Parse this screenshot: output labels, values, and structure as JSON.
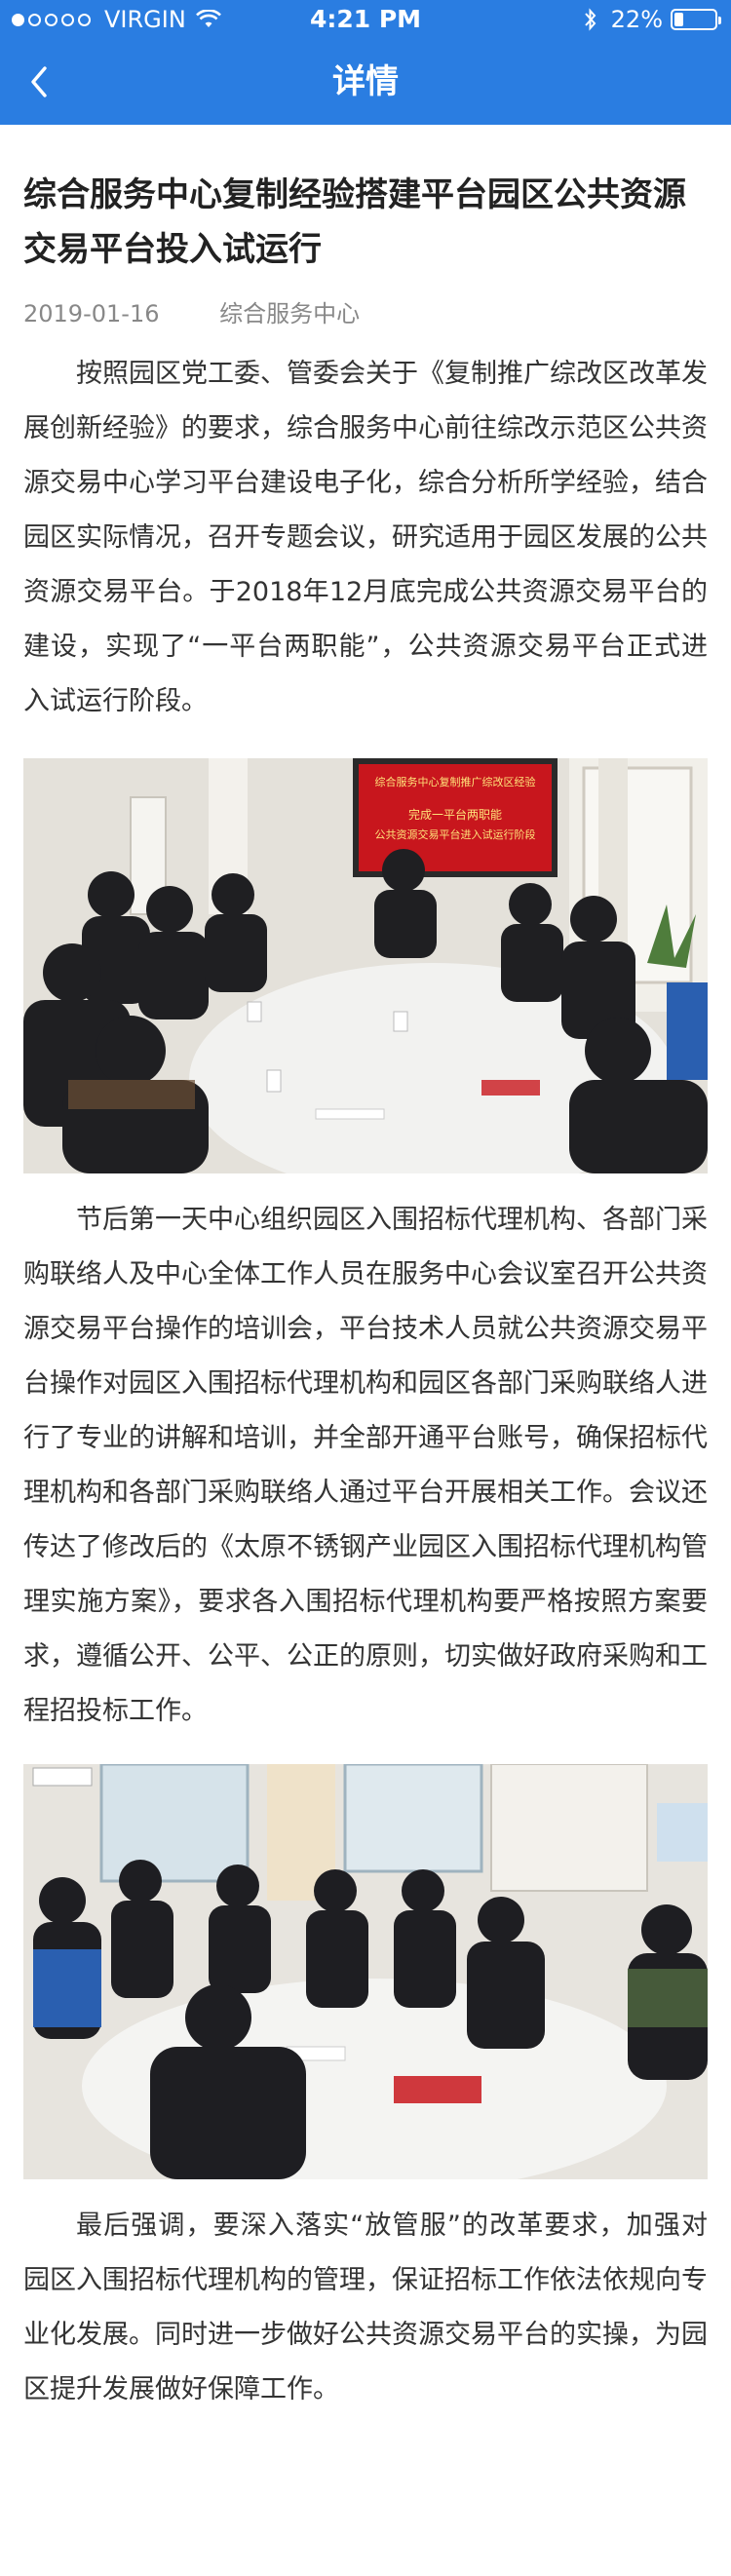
{
  "status_bar": {
    "carrier": "VIRGIN",
    "time": "4:21 PM",
    "battery": "22%",
    "battery_level": 0.22
  },
  "nav": {
    "title": "详情"
  },
  "article": {
    "title": "综合服务中心复制经验搭建平台园区公共资源交易平台投入试运行",
    "date": "2019-01-16",
    "source": "综合服务中心",
    "paragraphs": [
      "按照园区党工委、管委会关于《复制推广综改区改革发展创新经验》的要求，综合服务中心前往综改示范区公共资源交易中心学习平台建设电子化，综合分析所学经验，结合园区实际情况，召开专题会议，研究适用于园区发展的公共资源交易平台。于2018年12月底完成公共资源交易平台的建设，实现了“一平台两职能”，公共资源交易平台正式进入试运行阶段。",
      "节后第一天中心组织园区入围招标代理机构、各部门采购联络人及中心全体工作人员在服务中心会议室召开公共资源交易平台操作的培训会，平台技术人员就公共资源交易平台操作对园区入围招标代理机构和园区各部门采购联络人进行了专业的讲解和培训，并全部开通平台账号，确保招标代理机构和各部门采购联络人通过平台开展相关工作。会议还传达了修改后的《太原不锈钢产业园区入围招标代理机构管理实施方案》，要求各入围招标代理机构要严格按照方案要求，遵循公开、公平、公正的原则，切实做好政府采购和工程招投标工作。",
      "最后强调，要深入落实“放管服”的改革要求，加强对园区入围招标代理机构的管理，保证招标工作依法依规向专业化发展。同时进一步做好公共资源交易平台的实操，为园区提升发展做好保障工作。"
    ],
    "photo1_screen_lines": [
      "综合服务中心复制推广综改区经验",
      "完成一平台两职能",
      "公共资源交易平台进入试运行阶段"
    ]
  },
  "colors": {
    "nav_blue": "#2a7de1",
    "screen_red": "#c8161d",
    "text": "#333333",
    "meta": "#888888"
  },
  "icons": {
    "back": "chevron-left-icon",
    "wifi": "wifi-icon",
    "bluetooth": "bluetooth-icon",
    "battery": "battery-icon"
  }
}
